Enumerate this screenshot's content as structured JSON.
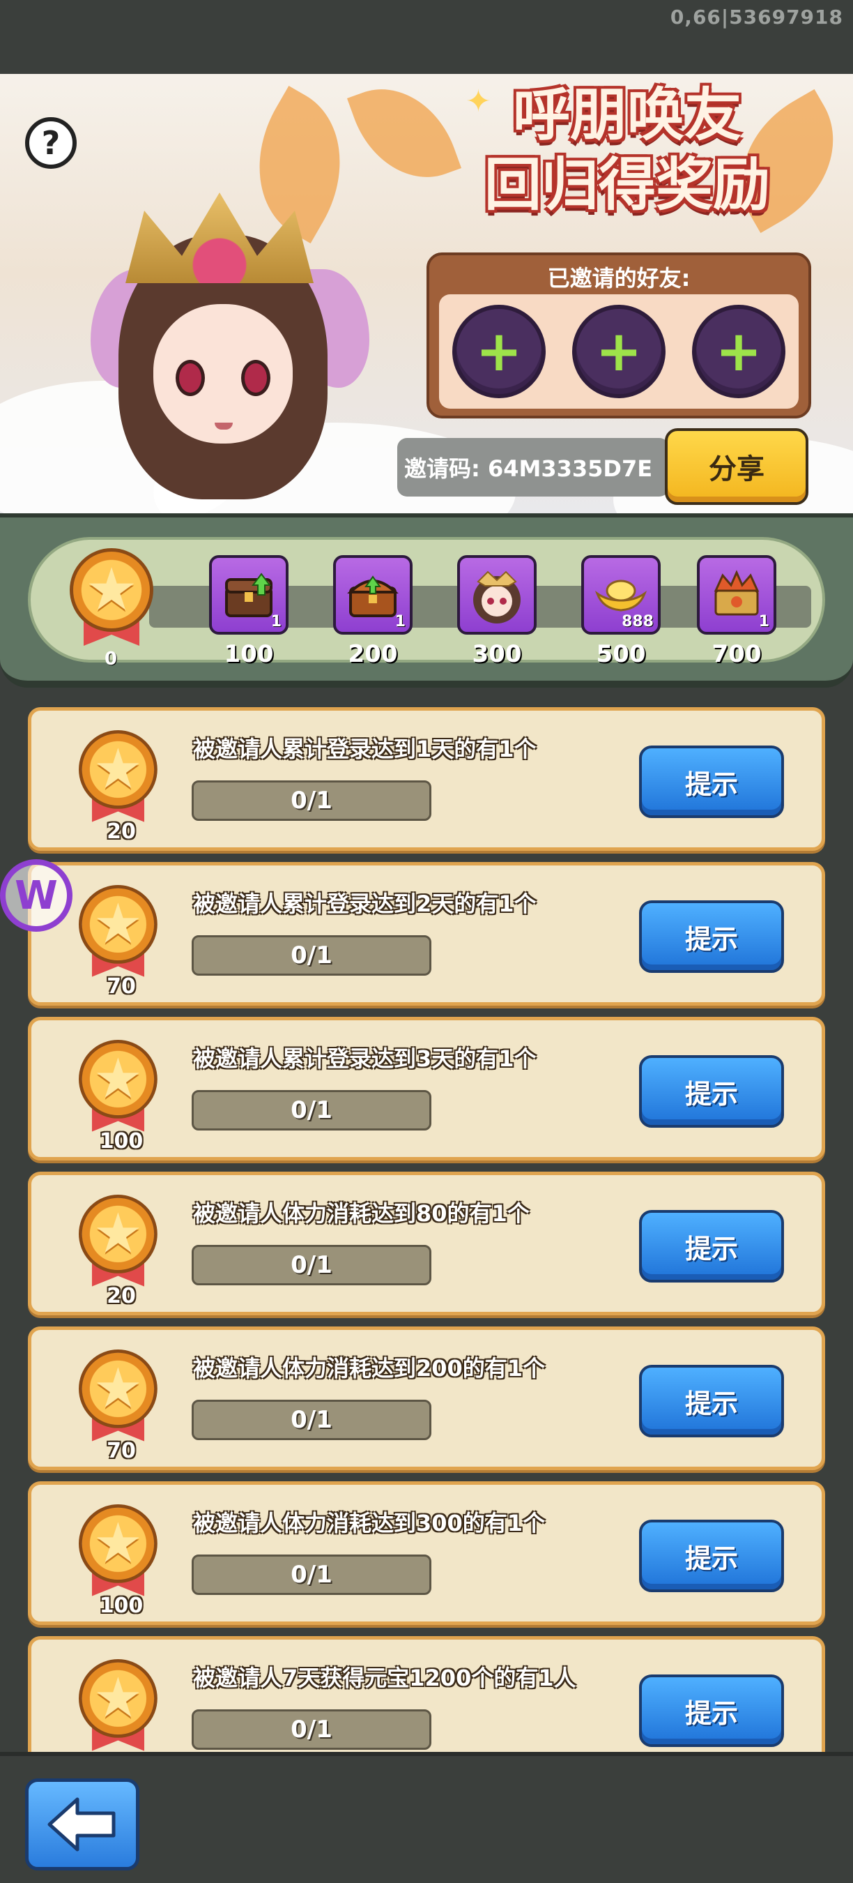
{
  "status": {
    "build": "0,66|53697918"
  },
  "banner": {
    "title_line1": "呼朋唤友",
    "title_line2": "回归得奖励",
    "help_label": "?",
    "invited_label": "已邀请的好友:",
    "invite_slots": [
      "+",
      "+",
      "+"
    ],
    "invite_code": "邀请码: 64M3335D7E",
    "share_label": "分享"
  },
  "progress": {
    "current": "0",
    "fill_fraction": 0,
    "rewards": [
      {
        "points": "100",
        "count": "1",
        "icon": "chest-upgrade-icon"
      },
      {
        "points": "200",
        "count": "1",
        "icon": "chest-upgrade-icon"
      },
      {
        "points": "300",
        "count": "",
        "icon": "character-avatar-icon"
      },
      {
        "points": "500",
        "count": "888",
        "icon": "gold-ingot-icon"
      },
      {
        "points": "700",
        "count": "1",
        "icon": "armor-crate-icon"
      }
    ]
  },
  "tasks": [
    {
      "reward": "20",
      "desc": "被邀请人累计登录达到1天的有1个",
      "progress": "0/1",
      "button": "提示"
    },
    {
      "reward": "70",
      "desc": "被邀请人累计登录达到2天的有1个",
      "progress": "0/1",
      "button": "提示"
    },
    {
      "reward": "100",
      "desc": "被邀请人累计登录达到3天的有1个",
      "progress": "0/1",
      "button": "提示"
    },
    {
      "reward": "20",
      "desc": "被邀请人体力消耗达到80的有1个",
      "progress": "0/1",
      "button": "提示"
    },
    {
      "reward": "70",
      "desc": "被邀请人体力消耗达到200的有1个",
      "progress": "0/1",
      "button": "提示"
    },
    {
      "reward": "100",
      "desc": "被邀请人体力消耗达到300的有1个",
      "progress": "0/1",
      "button": "提示"
    },
    {
      "reward": "",
      "desc": "被邀请人7天获得元宝1200个的有1人",
      "progress": "0/1",
      "button": "提示"
    }
  ],
  "overlay_logo": "W",
  "colors": {
    "accent_blue": "#2a7cdd",
    "share_yellow": "#f3b51e",
    "card_bg": "#f2e6c8",
    "panel_green": "#5f7563"
  }
}
